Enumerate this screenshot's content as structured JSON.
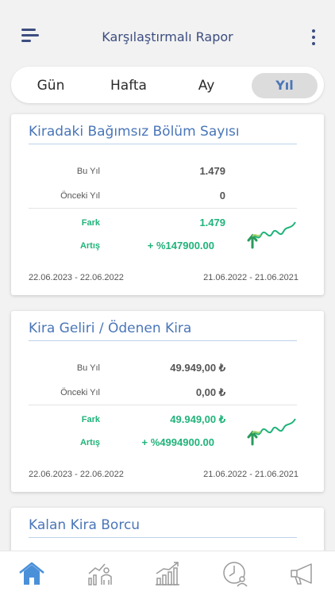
{
  "header": {
    "title": "Karşılaştırmalı Rapor"
  },
  "tabs": [
    {
      "label": "Gün",
      "active": false
    },
    {
      "label": "Hafta",
      "active": false
    },
    {
      "label": "Ay",
      "active": false
    },
    {
      "label": "Yıl",
      "active": true
    }
  ],
  "cards": [
    {
      "title": "Kiradaki Bağımsız Bölüm Sayısı",
      "this_year_label": "Bu Yıl",
      "this_year_value": "1.479",
      "prev_year_label": "Önceki Yıl",
      "prev_year_value": "0",
      "diff_label": "Fark",
      "diff_value": "1.479",
      "increase_label": "Artış",
      "increase_value": "+ %147900.00",
      "current_range": "22.06.2023 - 22.06.2022",
      "previous_range": "21.06.2022 - 21.06.2021"
    },
    {
      "title": "Kira Geliri / Ödenen Kira",
      "this_year_label": "Bu Yıl",
      "this_year_value": "49.949,00 ₺",
      "prev_year_label": "Önceki Yıl",
      "prev_year_value": "0,00 ₺",
      "diff_label": "Fark",
      "diff_value": "49.949,00 ₺",
      "increase_label": "Artış",
      "increase_value": "+ %4994900.00",
      "current_range": "22.06.2023 - 22.06.2022",
      "previous_range": "21.06.2022 - 21.06.2021"
    },
    {
      "title": "Kalan Kira Borcu"
    }
  ],
  "bottom_nav": [
    {
      "icon": "home-icon",
      "active": true
    },
    {
      "icon": "tenants-chart-icon",
      "active": false
    },
    {
      "icon": "growth-chart-icon",
      "active": false
    },
    {
      "icon": "clock-user-icon",
      "active": false
    },
    {
      "icon": "megaphone-icon",
      "active": false
    }
  ],
  "colors": {
    "accent": "#4a76b8",
    "header_text": "#3c4d80",
    "positive": "#20b37a",
    "active_nav": "#4a90d9",
    "inactive_nav": "#9a9a9a"
  }
}
